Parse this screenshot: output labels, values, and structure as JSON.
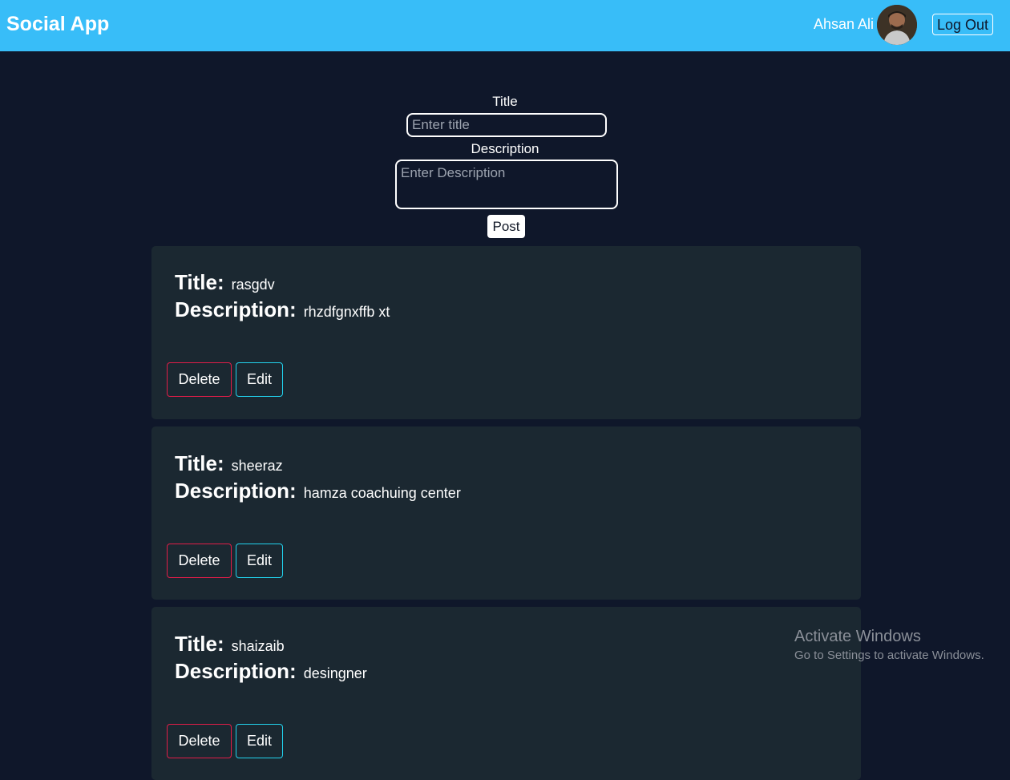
{
  "navbar": {
    "brand": "Social App",
    "username": "Ahsan Ali",
    "avatar_icon": "user-avatar-photo",
    "logout_label": "Log Out",
    "color": "#38bdf8"
  },
  "form": {
    "title_label": "Title",
    "title_placeholder": "Enter title",
    "title_value": "",
    "description_label": "Description",
    "description_placeholder": "Enter Description",
    "description_value": "",
    "post_label": "Post"
  },
  "posts": [
    {
      "title_key": "Title:",
      "title": "rasgdv",
      "description_key": "Description:",
      "description": "rhzdfgnxffb xt",
      "delete_label": "Delete",
      "edit_label": "Edit"
    },
    {
      "title_key": "Title:",
      "title": "sheeraz",
      "description_key": "Description:",
      "description": "hamza coachuing center",
      "delete_label": "Delete",
      "edit_label": "Edit"
    },
    {
      "title_key": "Title:",
      "title": "shaizaib",
      "description_key": "Description:",
      "description": "desingner",
      "delete_label": "Delete",
      "edit_label": "Edit"
    }
  ],
  "watermark": {
    "line1": "Activate Windows",
    "line2": "Go to Settings to activate Windows."
  },
  "colors": {
    "background": "#0f172a",
    "card": "#1b2831",
    "delete_border": "#e11d48",
    "edit_border": "#22d3ee"
  }
}
